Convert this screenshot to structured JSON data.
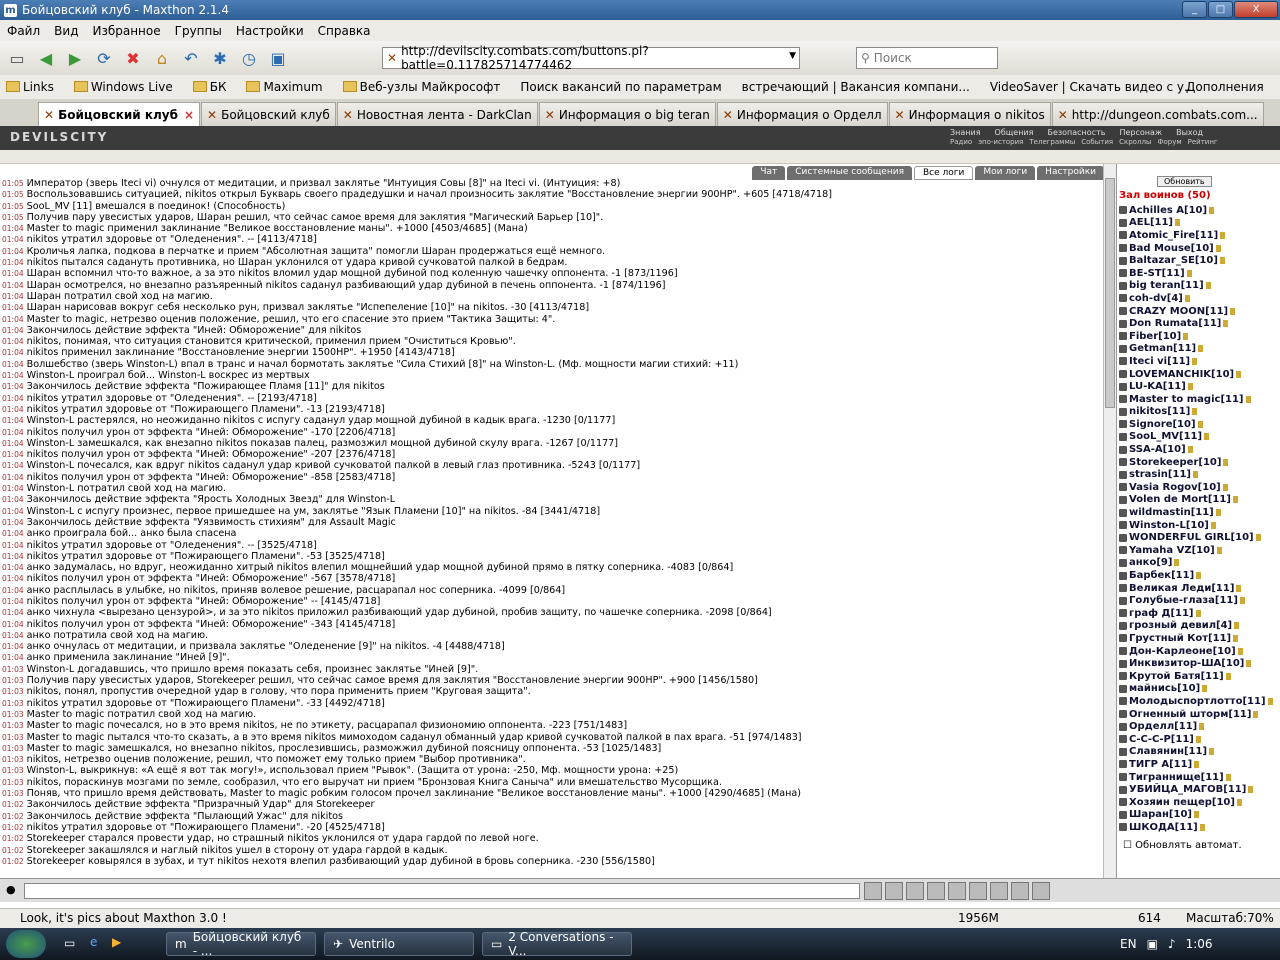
{
  "window": {
    "title": "Бойцовский клуб - Maxthon 2.1.4"
  },
  "menu": [
    "Файл",
    "Вид",
    "Избранное",
    "Группы",
    "Настройки",
    "Справка"
  ],
  "address": {
    "url": "http://devilscity.combats.com/buttons.pl?battle=0.117825714774462"
  },
  "search": {
    "placeholder": "Поиск"
  },
  "links": [
    "Links",
    "Windows Live",
    "БК",
    "Maximum",
    "Веб-узлы Майкрософт",
    "Поиск вакансий по параметрам",
    "встречающий | Вакансия компани...",
    "VideoSaver | Скачать видео с у...",
    "Дополнения"
  ],
  "tabs": [
    "Бойцовский клуб",
    "Бойцовский клуб",
    "Новостная лента - DarkClan",
    "Информация о big teran",
    "Информация о Орделл",
    "Информация о nikitos",
    "http://dungeon.combats.com..."
  ],
  "site": {
    "logo": "DEVILSCITY",
    "nav": [
      "Знания",
      "Общения",
      "Безопасность",
      "Персонаж",
      "Выход"
    ],
    "nav2": [
      "Радио",
      "эпо-история",
      "Телеграммы",
      "События",
      "Скроллы",
      "Форум",
      "Рейтинг"
    ]
  },
  "chat_tabs": [
    "Чат",
    "Системные сообщения",
    "Все логи",
    "Мои логи",
    "Настройки"
  ],
  "log": [
    {
      "t": "01:05",
      "s": "Император (зверь Iteci vi) очнулся от медитации, и призвал заклятье \"Интуиция Совы [8]\" на Iteci vi. (Интуиция: +8)"
    },
    {
      "t": "01:05",
      "s": "Воспользовавшись ситуацией, nikitos открыл Букварь своего прадедушки и начал произносить заклятие \"Восстановление энергии 900НР\". +605 [4718/4718]"
    },
    {
      "t": "01:05",
      "s": "SooL_MV [11] вмешался в поединок! (Способность)"
    },
    {
      "t": "01:05",
      "s": "Получив пару увесистых ударов, Шаран решил, что сейчас самое время для заклятия \"Магический Барьер [10]\"."
    },
    {
      "t": "01:04",
      "s": "Master to magic применил заклинание \"Великое восстановление маны\". +1000 [4503/4685] (Мана)"
    },
    {
      "t": "01:04",
      "s": "nikitos утратил здоровье от \"Оледенения\". -- [4113/4718]"
    },
    {
      "t": "01:04",
      "s": "Кроличья лапка, подкова в перчатке и прием \"Абсолютная защита\" помогли Шаран продержаться ещё немного."
    },
    {
      "t": "01:04",
      "s": "nikitos пытался садануть противника, но Шаран уклонился от удара кривой сучковатой палкой в бедрам."
    },
    {
      "t": "01:04",
      "s": "Шаран вспомнил что-то важное, а за это nikitos вломил удар мощной дубиной под коленную чашечку оппонента. -1 [873/1196]"
    },
    {
      "t": "01:04",
      "s": "Шаран осмотрелся, но внезапно разъяренный nikitos саданул разбивающий удар дубиной в печень оппонента. -1 [874/1196]"
    },
    {
      "t": "01:04",
      "s": "Шаран потратил свой ход на магию."
    },
    {
      "t": "01:04",
      "s": "Шаран нарисовав вокруг себя несколько рун, призвал заклятье \"Испепеление [10]\" на nikitos. -30 [4113/4718]"
    },
    {
      "t": "01:04",
      "s": "Master to magic, нетрезво оценив положение, решил, что его спасение это прием \"Тактика Защиты: 4\"."
    },
    {
      "t": "01:04",
      "s": "Закончилось действие эффекта \"Иней: Обморожение\" для nikitos"
    },
    {
      "t": "01:04",
      "s": "nikitos, понимая, что ситуация становится критической, применил прием \"Очиститься Кровью\"."
    },
    {
      "t": "01:04",
      "s": "nikitos применил заклинание \"Восстановление энергии 1500НР\". +1950 [4143/4718]"
    },
    {
      "t": "01:04",
      "s": "Волшебство (зверь Winston-L) впал в транс и начал бормотать заклятье \"Сила Стихий [8]\" на Winston-L. (Мф. мощности магии стихий: +11)"
    },
    {
      "t": "01:04",
      "s": "Winston-L проиграл бой... Winston-L воскрес из мертвых"
    },
    {
      "t": "01:04",
      "s": "Закончилось действие эффекта \"Пожирающее Пламя [11]\" для nikitos"
    },
    {
      "t": "01:04",
      "s": "nikitos утратил здоровье от \"Оледенения\". -- [2193/4718]"
    },
    {
      "t": "01:04",
      "s": "nikitos утратил здоровье от \"Пожирающего Пламени\". -13 [2193/4718]"
    },
    {
      "t": "01:04",
      "s": "Winston-L растерялся, но неожиданно nikitos с испугу саданул удар мощной дубиной в кадык врага. -1230 [0/1177]"
    },
    {
      "t": "01:04",
      "s": "nikitos получил урон от эффекта \"Иней: Обморожение\" -170 [2206/4718]"
    },
    {
      "t": "01:04",
      "s": "Winston-L замешкался, как внезапно nikitos показав палец, размозжил мощной дубиной скулу врага. -1267 [0/1177]"
    },
    {
      "t": "01:04",
      "s": "nikitos получил урон от эффекта \"Иней: Обморожение\" -207 [2376/4718]"
    },
    {
      "t": "01:04",
      "s": "Winston-L почесался, как вдруг nikitos саданул удар кривой сучковатой палкой в левый глаз противника. -5243 [0/1177]"
    },
    {
      "t": "01:04",
      "s": "nikitos получил урон от эффекта \"Иней: Обморожение\" -858 [2583/4718]"
    },
    {
      "t": "01:04",
      "s": "Winston-L потратил свой ход на магию."
    },
    {
      "t": "01:04",
      "s": "Закончилось действие эффекта \"Ярость Холодных Звезд\" для Winston-L"
    },
    {
      "t": "01:04",
      "s": "Winston-L с испугу произнес, первое пришедшее на ум, заклятье \"Язык Пламени [10]\" на nikitos. -84 [3441/4718]"
    },
    {
      "t": "01:04",
      "s": "Закончилось действие эффекта \"Уязвимость стихиям\" для Assault Magic"
    },
    {
      "t": "01:04",
      "s": "анко проиграла бой... анко была спасена"
    },
    {
      "t": "01:04",
      "s": "nikitos утратил здоровье от \"Оледенения\". -- [3525/4718]"
    },
    {
      "t": "01:04",
      "s": "nikitos утратил здоровье от \"Пожирающего Пламени\". -53 [3525/4718]"
    },
    {
      "t": "01:04",
      "s": "анко задумалась, но вдруг, неожиданно хитрый nikitos влепил мощнейший удар мощной дубиной прямо в пятку соперника. -4083 [0/864]"
    },
    {
      "t": "01:04",
      "s": "nikitos получил урон от эффекта \"Иней: Обморожение\" -567 [3578/4718]"
    },
    {
      "t": "01:04",
      "s": "анко расплылась в улыбке, но nikitos, приняв волевое решение, расцарапал нос соперника. -4099 [0/864]"
    },
    {
      "t": "01:04",
      "s": "nikitos получил урон от эффекта \"Иней: Обморожение\" -- [4145/4718]"
    },
    {
      "t": "01:04",
      "s": "анко чихнула <вырезано цензурой>, и за это nikitos приложил разбивающий удар дубиной, пробив защиту, по чашечке соперника. -2098 [0/864]"
    },
    {
      "t": "01:04",
      "s": "nikitos получил урон от эффекта \"Иней: Обморожение\" -343 [4145/4718]"
    },
    {
      "t": "01:04",
      "s": "анко потратила свой ход на магию."
    },
    {
      "t": "01:04",
      "s": "анко очнулась от медитации, и призвала заклятье \"Оледенение [9]\" на nikitos. -4 [4488/4718]"
    },
    {
      "t": "01:04",
      "s": "анко применила заклинание \"Иней [9]\"."
    },
    {
      "t": "01:03",
      "s": "Winston-L догадавшись, что пришло время показать себя, произнес заклятье \"Иней [9]\"."
    },
    {
      "t": "01:03",
      "s": "Получив пару увесистых ударов, Storekeeper решил, что сейчас самое время для заклятия \"Восстановление энергии 900НР\". +900 [1456/1580]"
    },
    {
      "t": "01:03",
      "s": "nikitos, понял, пропустив очередной удар в голову, что пора применить прием \"Круговая защита\"."
    },
    {
      "t": "01:03",
      "s": "nikitos утратил здоровье от \"Пожирающего Пламени\". -33 [4492/4718]"
    },
    {
      "t": "01:03",
      "s": "Master to magic потратил свой ход на магию."
    },
    {
      "t": "01:03",
      "s": "Master to magic почесался, но в это время nikitos, не по этикету, расцарапал физиономию оппонента. -223 [751/1483]"
    },
    {
      "t": "01:03",
      "s": "Master to magic пытался что-то сказать, а в это время nikitos мимоходом саданул обманный удар кривой сучковатой палкой в пах врага. -51 [974/1483]"
    },
    {
      "t": "01:03",
      "s": "Master to magic замешкался, но внезапно nikitos, прослезившись, разможжил дубиной поясницу оппонента. -53 [1025/1483]"
    },
    {
      "t": "01:03",
      "s": "nikitos, нетрезво оценив положение, решил, что поможет ему только прием \"Выбор противника\"."
    },
    {
      "t": "01:03",
      "s": "Winston-L, выкрикнув: «А ещё я вот так могу!», использовал прием \"Рывок\". (Защита от урона: -250, Мф. мощности урона: +25)"
    },
    {
      "t": "01:03",
      "s": "nikitos, пораскинув мозгами по земле, сообразил, что его выручат ни прием \"Бронзовая Книга Саныча\" или вмешательство Мусорщика."
    },
    {
      "t": "01:03",
      "s": "Поняв, что пришло время действовать, Master to magic робким голосом прочел заклинание \"Великое восстановление маны\". +1000 [4290/4685] (Мана)"
    },
    {
      "t": "01:02",
      "s": "Закончилось действие эффекта \"Призрачный Удар\" для Storekeeper"
    },
    {
      "t": "01:02",
      "s": "Закончилось действие эффекта \"Пылающий Ужас\" для nikitos"
    },
    {
      "t": "01:02",
      "s": "nikitos утратил здоровье от \"Пожирающего Пламени\". -20 [4525/4718]"
    },
    {
      "t": "01:02",
      "s": "Storekeeper старался провести удар, но страшный nikitos уклонился от удара гардой по левой ноге."
    },
    {
      "t": "01:02",
      "s": "Storekeeper закашлялся и наглый nikitos ушел в сторону от удара гардой в кадык."
    },
    {
      "t": "01:02",
      "s": "Storekeeper ковырялся в зубах, и тут nikitos нехотя влепил разбивающий удар дубиной в бровь соперника. -230 [556/1580]"
    }
  ],
  "side": {
    "refresh": "Обновить",
    "hall": "Зал воинов (50)",
    "players": [
      "Achilles A[10]",
      "AEL[11]",
      "Atomic_Fire[11]",
      "Bad Mouse[10]",
      "Baltazar_SE[10]",
      "BE-ST[11]",
      "big teran[11]",
      "coh-dv[4]",
      "CRAZY MOON[11]",
      "Don Rumata[11]",
      "Fiber[10]",
      "Getman[11]",
      "Iteci vi[11]",
      "LOVEMANCHIK[10]",
      "LU-KA[11]",
      "Master to magic[11]",
      "nikitos[11]",
      "Signore[10]",
      "SooL_MV[11]",
      "SSA-A[10]",
      "Storekeeper[10]",
      "strasin[11]",
      "Vasia Rogov[10]",
      "Volen de Mort[11]",
      "wildmastin[11]",
      "Winston-L[10]",
      "WONDERFUL GIRL[10]",
      "Yamaha VZ[10]",
      "анко[9]",
      "Барбек[11]",
      "Великая Леди[11]",
      "Голубые-глаза[11]",
      "граф Д[11]",
      "грозный девил[4]",
      "Грустный Кот[11]",
      "Дон-Карлеоне[10]",
      "Инквизитор-ША[10]",
      "Крутой Батя[11]",
      "майнись[10]",
      "Молодыспортлотто[11]",
      "Огненный шторм[11]",
      "Орделл[11]",
      "С-С-С-Р[11]",
      "Славянин[11]",
      "ТИГР А[11]",
      "Тиграннище[11]",
      "УБИЙЦА_МАГОВ[11]",
      "Хозяин пещер[10]",
      "Шаран[10]",
      "ШКОДА[11]"
    ],
    "auto": "Обновлять автомат."
  },
  "status": {
    "left": "Look, it's pics about Maxthon 3.0 !",
    "mem": "1956M",
    "count": "614",
    "zoom": "Масштаб:70%"
  },
  "taskbar": {
    "items": [
      "Бойцовский клуб - ...",
      "Ventrilo",
      "2 Conversations - V..."
    ],
    "lang": "EN",
    "clock": "1:06"
  }
}
